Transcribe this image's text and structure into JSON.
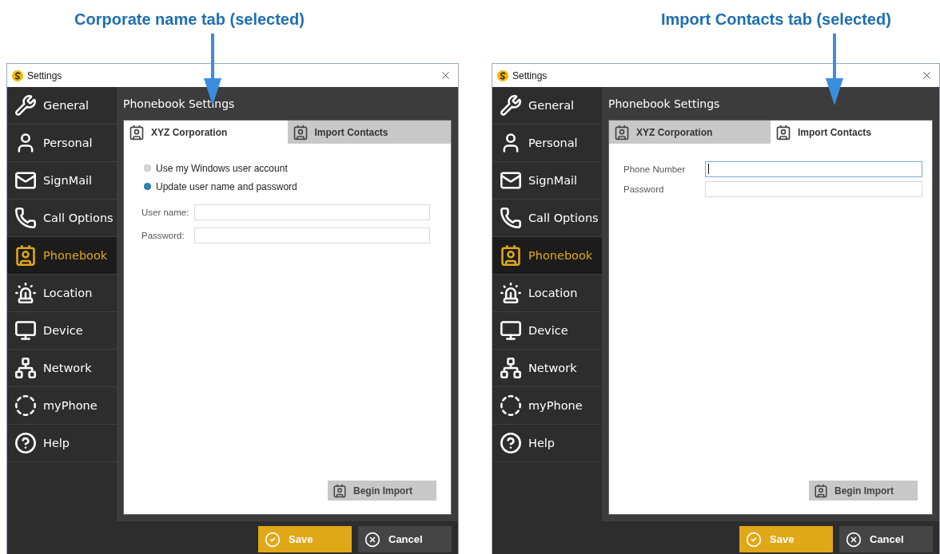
{
  "windows": [
    {
      "callout": "Corporate name tab (selected)",
      "title": "Settings",
      "sidebar": {
        "items": [
          {
            "label": "General",
            "selected": false
          },
          {
            "label": "Personal",
            "selected": false
          },
          {
            "label": "SignMail",
            "selected": false
          },
          {
            "label": "Call Options",
            "selected": false
          },
          {
            "label": "Phonebook",
            "selected": true
          },
          {
            "label": "Location",
            "selected": false
          },
          {
            "label": "Device",
            "selected": false
          },
          {
            "label": "Network",
            "selected": false
          },
          {
            "label": "myPhone",
            "selected": false
          },
          {
            "label": "Help",
            "selected": false
          }
        ]
      },
      "heading": "Phonebook Settings",
      "tabs": [
        {
          "label": "XYZ Corporation",
          "selected": true
        },
        {
          "label": "Import Contacts",
          "selected": false
        }
      ],
      "panel": {
        "kind": "corporate",
        "options": [
          {
            "label": "Use my Windows user account",
            "selected": false
          },
          {
            "label": "Update user name and password",
            "selected": true
          }
        ],
        "fields": [
          {
            "label": "User name:",
            "focused": false
          },
          {
            "label": "Password:",
            "focused": false
          }
        ]
      },
      "import_button": "Begin Import",
      "buttons": [
        {
          "label": "Save",
          "kind": "primary"
        },
        {
          "label": "Cancel",
          "kind": "secondary"
        }
      ]
    },
    {
      "callout": "Import Contacts tab (selected)",
      "title": "Settings",
      "sidebar": {
        "items": [
          {
            "label": "General",
            "selected": false
          },
          {
            "label": "Personal",
            "selected": false
          },
          {
            "label": "SignMail",
            "selected": false
          },
          {
            "label": "Call Options",
            "selected": false
          },
          {
            "label": "Phonebook",
            "selected": true
          },
          {
            "label": "Location",
            "selected": false
          },
          {
            "label": "Device",
            "selected": false
          },
          {
            "label": "Network",
            "selected": false
          },
          {
            "label": "myPhone",
            "selected": false
          },
          {
            "label": "Help",
            "selected": false
          }
        ]
      },
      "heading": "Phonebook Settings",
      "tabs": [
        {
          "label": "XYZ Corporation",
          "selected": false
        },
        {
          "label": "Import Contacts",
          "selected": true
        }
      ],
      "panel": {
        "kind": "import",
        "fields": [
          {
            "label": "Phone Number",
            "focused": true
          },
          {
            "label": "Password",
            "focused": false
          }
        ]
      },
      "import_button": "Begin Import",
      "buttons": [
        {
          "label": "Save",
          "kind": "primary"
        },
        {
          "label": "Cancel",
          "kind": "secondary"
        }
      ]
    }
  ]
}
